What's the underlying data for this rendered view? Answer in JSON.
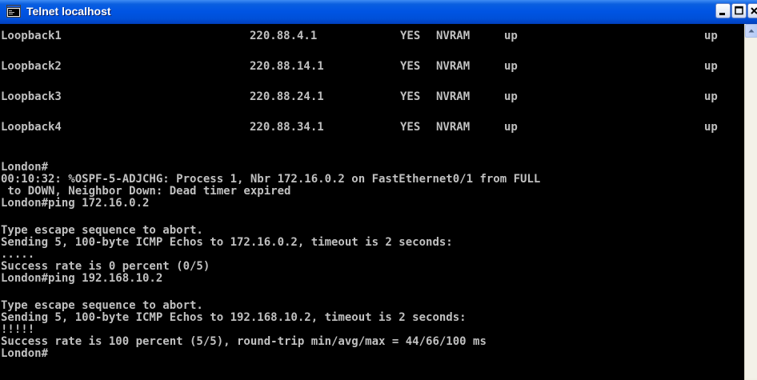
{
  "window": {
    "title": "Telnet localhost"
  },
  "interfaces": [
    {
      "name": "Loopback1",
      "ip": "220.88.4.1",
      "ok": "YES",
      "method": "NVRAM",
      "status": "up",
      "protocol": "up"
    },
    {
      "name": "Loopback2",
      "ip": "220.88.14.1",
      "ok": "YES",
      "method": "NVRAM",
      "status": "up",
      "protocol": "up"
    },
    {
      "name": "Loopback3",
      "ip": "220.88.24.1",
      "ok": "YES",
      "method": "NVRAM",
      "status": "up",
      "protocol": "up"
    },
    {
      "name": "Loopback4",
      "ip": "220.88.34.1",
      "ok": "YES",
      "method": "NVRAM",
      "status": "up",
      "protocol": "up"
    }
  ],
  "log": {
    "l1": "London#",
    "l2": "00:10:32: %OSPF-5-ADJCHG: Process 1, Nbr 172.16.0.2 on FastEthernet0/1 from FULL",
    "l3": " to DOWN, Neighbor Down: Dead timer expired",
    "l4": "London#ping 172.16.0.2",
    "l5": "Type escape sequence to abort.",
    "l6": "Sending 5, 100-byte ICMP Echos to 172.16.0.2, timeout is 2 seconds:",
    "l7": ".....",
    "l8": "Success rate is 0 percent (0/5)",
    "l9": "London#ping 192.168.10.2",
    "l10": "Type escape sequence to abort.",
    "l11": "Sending 5, 100-byte ICMP Echos to 192.168.10.2, timeout is 2 seconds:",
    "l12": "!!!!!",
    "l13": "Success rate is 100 percent (5/5), round-trip min/avg/max = 44/66/100 ms",
    "l14": "London#"
  },
  "icons": {
    "window": "telnet-terminal-icon",
    "minimize": "minimize-icon",
    "maximize": "maximize-icon",
    "close": "close-icon",
    "scroll_up": "scroll-up-arrow-icon"
  },
  "colors": {
    "titlebar": "#0054e3",
    "console_bg": "#000000",
    "console_text": "#c0c0c0"
  }
}
